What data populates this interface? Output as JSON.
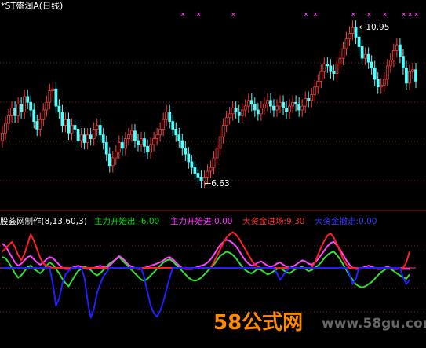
{
  "header": {
    "stock_name": "*ST盛润A(日线)"
  },
  "indicator_header": {
    "name": "股荟网制作(8,13,60,3)",
    "items": [
      {
        "label": "主力开始出",
        "value": "-6.00",
        "color": "#00dd00"
      },
      {
        "label": "主力开始进",
        "value": "0.00",
        "color": "#ff33ff"
      },
      {
        "label": "大资金进场",
        "value": "9.30",
        "color": "#ff3030"
      },
      {
        "label": "大资金撤走",
        "value": "0.00",
        "color": "#3a3aff"
      }
    ]
  },
  "watermark": {
    "brand": "58公式网",
    "url": "www.58gu.com"
  },
  "colors": {
    "up_candle": "#ff3c3c",
    "down_candle": "#54ffff",
    "line_green": "#33dd33",
    "line_blue": "#2020ff",
    "line_red": "#ff2020",
    "line_magenta": "#ff44ff",
    "marker": "#ff44ff",
    "grid": "#8a1a1a"
  },
  "chart_data": [
    {
      "type": "candlestick",
      "title": "*ST盛润A(日线)",
      "ylim": [
        6.2,
        11.2
      ],
      "annotations": [
        {
          "text": "10.95",
          "kind": "high",
          "index": 112,
          "value": 10.95
        },
        {
          "text": "6.63",
          "kind": "low",
          "index": 63,
          "value": 6.63
        }
      ],
      "signal_markers_x_index": [
        57,
        62,
        73,
        96,
        99,
        111,
        116,
        121,
        127,
        129,
        131
      ],
      "close": [
        8.1,
        8.35,
        8.55,
        8.75,
        8.55,
        8.85,
        8.65,
        9.05,
        8.9,
        8.7,
        8.4,
        8.2,
        8.45,
        8.7,
        8.9,
        9.2,
        9.25,
        8.8,
        8.65,
        8.3,
        8.45,
        8.1,
        8.3,
        8.2,
        7.9,
        8.05,
        7.85,
        8.05,
        7.95,
        8.2,
        8.3,
        8.05,
        7.85,
        7.55,
        7.25,
        7.45,
        7.6,
        7.85,
        7.7,
        7.95,
        8.05,
        8.15,
        7.9,
        7.8,
        7.95,
        7.75,
        7.6,
        7.8,
        7.95,
        8.05,
        8.2,
        8.45,
        8.65,
        8.4,
        8.2,
        8.05,
        7.9,
        7.7,
        7.55,
        7.35,
        7.2,
        7.05,
        6.95,
        6.85,
        6.95,
        7.1,
        7.2,
        7.45,
        7.7,
        8.0,
        8.3,
        8.5,
        8.6,
        8.75,
        8.65,
        8.55,
        8.7,
        8.8,
        8.95,
        8.85,
        8.7,
        8.6,
        8.75,
        8.85,
        8.95,
        8.8,
        8.7,
        8.8,
        8.9,
        8.75,
        8.65,
        8.8,
        8.9,
        8.85,
        8.7,
        8.8,
        9.0,
        8.95,
        9.1,
        9.3,
        9.45,
        9.7,
        9.9,
        9.85,
        9.7,
        9.65,
        9.9,
        10.05,
        10.3,
        10.55,
        10.7,
        10.85,
        10.6,
        10.35,
        10.05,
        10.15,
        9.95,
        9.8,
        9.5,
        9.3,
        9.35,
        9.5,
        9.85,
        10.0,
        10.25,
        10.4,
        10.1,
        9.8,
        9.4,
        9.7,
        9.75,
        9.45
      ],
      "open": [
        7.9,
        8.1,
        8.35,
        8.55,
        8.75,
        8.55,
        8.85,
        8.65,
        9.05,
        8.9,
        8.7,
        8.4,
        8.2,
        8.45,
        8.7,
        8.9,
        9.2,
        9.25,
        8.8,
        8.65,
        8.3,
        8.45,
        8.1,
        8.3,
        8.2,
        7.9,
        8.05,
        7.85,
        8.05,
        7.95,
        8.2,
        8.3,
        8.05,
        7.85,
        7.55,
        7.25,
        7.45,
        7.6,
        7.85,
        7.7,
        7.95,
        8.05,
        8.15,
        7.9,
        7.8,
        7.95,
        7.75,
        7.6,
        7.8,
        7.95,
        8.05,
        8.2,
        8.45,
        8.65,
        8.4,
        8.2,
        8.05,
        7.9,
        7.7,
        7.55,
        7.35,
        7.2,
        7.05,
        6.95,
        6.85,
        6.95,
        7.1,
        7.2,
        7.45,
        7.7,
        8.0,
        8.3,
        8.5,
        8.6,
        8.75,
        8.65,
        8.55,
        8.7,
        8.8,
        8.95,
        8.85,
        8.7,
        8.6,
        8.75,
        8.85,
        8.95,
        8.8,
        8.7,
        8.8,
        8.9,
        8.75,
        8.65,
        8.8,
        8.9,
        8.85,
        8.7,
        8.8,
        9.0,
        8.95,
        9.1,
        9.3,
        9.45,
        9.7,
        9.9,
        9.85,
        9.7,
        9.65,
        9.9,
        10.05,
        10.3,
        10.55,
        10.7,
        10.85,
        10.6,
        10.35,
        10.05,
        10.15,
        9.95,
        9.8,
        9.5,
        9.3,
        9.35,
        9.5,
        9.85,
        10.0,
        10.25,
        10.4,
        10.1,
        9.8,
        9.4,
        9.7,
        9.75
      ]
    },
    {
      "type": "line",
      "title": "股荟网制作(8,13,60,3)",
      "ylim": [
        -100,
        100
      ],
      "series": [
        {
          "name": "主力开始出",
          "color": "#33dd33",
          "values": [
            20,
            18,
            10,
            0,
            -10,
            -18,
            -14,
            -6,
            2,
            4,
            -2,
            -6,
            -10,
            -4,
            4,
            10,
            6,
            -2,
            -10,
            -20,
            -28,
            -34,
            -24,
            -14,
            -6,
            -2,
            2,
            0,
            -4,
            -10,
            -14,
            -10,
            -4,
            2,
            8,
            12,
            16,
            20,
            14,
            8,
            2,
            -4,
            -10,
            -16,
            -22,
            -24,
            -20,
            -14,
            -8,
            -2,
            4,
            10,
            14,
            16,
            12,
            6,
            0,
            -6,
            -12,
            -18,
            -22,
            -24,
            -22,
            -18,
            -12,
            -6,
            0,
            6,
            14,
            22,
            26,
            30,
            28,
            24,
            18,
            10,
            2,
            -4,
            -8,
            -10,
            -6,
            -2,
            -4,
            -8,
            -12,
            -10,
            -6,
            -2,
            0,
            -4,
            -8,
            -10,
            -6,
            -2,
            0,
            2,
            -2,
            -6,
            -4,
            0,
            4,
            10,
            18,
            24,
            28,
            30,
            24,
            16,
            6,
            -4,
            -14,
            -22,
            -30,
            -34,
            -36,
            -34,
            -30,
            -26,
            -20,
            -14,
            -8,
            -4,
            0,
            -2,
            -6,
            -10,
            -14,
            -18,
            -20,
            -12
          ]
        },
        {
          "name": "主力开始进",
          "color": "#ff44ff",
          "values": [
            45,
            40,
            30,
            20,
            10,
            4,
            8,
            14,
            20,
            22,
            16,
            10,
            6,
            10,
            16,
            20,
            18,
            12,
            6,
            0,
            -2,
            -2,
            0,
            2,
            4,
            2,
            0,
            -2,
            -2,
            0,
            2,
            4,
            2,
            0,
            4,
            10,
            16,
            22,
            18,
            12,
            6,
            2,
            0,
            -2,
            -2,
            0,
            2,
            4,
            6,
            8,
            10,
            14,
            18,
            20,
            16,
            10,
            4,
            0,
            -2,
            -2,
            -2,
            0,
            2,
            4,
            6,
            10,
            16,
            24,
            34,
            42,
            48,
            52,
            50,
            46,
            40,
            32,
            22,
            14,
            8,
            4,
            6,
            10,
            12,
            8,
            4,
            2,
            4,
            8,
            10,
            6,
            2,
            0,
            2,
            6,
            10,
            14,
            12,
            8,
            6,
            10,
            16,
            24,
            32,
            40,
            46,
            48,
            42,
            34,
            24,
            14,
            6,
            0,
            -2,
            -2,
            0,
            2,
            4,
            2,
            0,
            -2,
            -2,
            0,
            2,
            0,
            -2,
            -2,
            0,
            -2,
            -2,
            -2
          ]
        },
        {
          "name": "大资金进场",
          "color": "#ff2020",
          "values": [
            30,
            36,
            42,
            48,
            38,
            24,
            14,
            26,
            44,
            62,
            50,
            34,
            18,
            8,
            4,
            2,
            0,
            0,
            0,
            0,
            0,
            0,
            0,
            0,
            0,
            0,
            0,
            0,
            0,
            0,
            0,
            0,
            0,
            0,
            0,
            0,
            0,
            0,
            0,
            0,
            0,
            0,
            0,
            0,
            0,
            0,
            0,
            0,
            0,
            0,
            0,
            0,
            0,
            0,
            0,
            0,
            0,
            0,
            0,
            0,
            0,
            0,
            0,
            0,
            0,
            0,
            0,
            10,
            22,
            34,
            46,
            56,
            62,
            66,
            62,
            54,
            44,
            34,
            24,
            14,
            6,
            2,
            0,
            0,
            0,
            0,
            0,
            0,
            0,
            0,
            0,
            0,
            0,
            0,
            0,
            0,
            0,
            0,
            0,
            10,
            24,
            38,
            50,
            60,
            64,
            56,
            44,
            30,
            16,
            6,
            0,
            0,
            0,
            0,
            0,
            0,
            0,
            0,
            0,
            0,
            0,
            0,
            0,
            0,
            0,
            0,
            0,
            0,
            10,
            30
          ]
        },
        {
          "name": "大资金撤走",
          "color": "#2020ff",
          "values": [
            0,
            0,
            0,
            0,
            0,
            0,
            0,
            0,
            0,
            0,
            0,
            0,
            0,
            0,
            0,
            0,
            -30,
            -70,
            -56,
            -30,
            -12,
            -6,
            0,
            0,
            0,
            0,
            -18,
            -60,
            -92,
            -76,
            -46,
            -30,
            -16,
            -8,
            0,
            0,
            0,
            0,
            0,
            0,
            0,
            0,
            0,
            0,
            0,
            -18,
            -46,
            -70,
            -84,
            -90,
            -80,
            -62,
            -40,
            -18,
            0,
            0,
            0,
            0,
            0,
            0,
            0,
            0,
            0,
            0,
            0,
            0,
            0,
            0,
            0,
            0,
            0,
            0,
            0,
            0,
            0,
            0,
            0,
            0,
            0,
            0,
            0,
            0,
            0,
            0,
            0,
            0,
            0,
            -10,
            -22,
            -14,
            -6,
            0,
            0,
            0,
            0,
            0,
            0,
            0,
            0,
            0,
            0,
            0,
            0,
            0,
            0,
            0,
            0,
            0,
            0,
            0,
            -12,
            -30,
            -20,
            0,
            0,
            0,
            0,
            0,
            0,
            0,
            0,
            0,
            0,
            0,
            0,
            0,
            0,
            -18,
            -30,
            -22
          ]
        }
      ]
    }
  ]
}
